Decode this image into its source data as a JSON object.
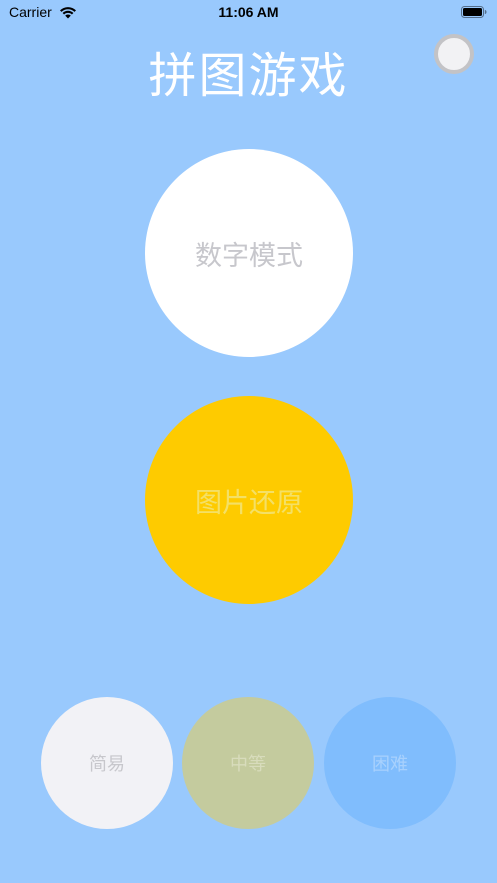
{
  "status_bar": {
    "carrier": "Carrier",
    "time": "11:06 AM",
    "wifi_icon": "wifi-icon",
    "battery_icon": "battery-icon"
  },
  "header": {
    "title": "拼图游戏",
    "toggle_icon": "circle-toggle-icon"
  },
  "modes": {
    "number_mode": "数字模式",
    "image_mode": "图片还原"
  },
  "difficulty": {
    "easy": "简易",
    "medium": "中等",
    "hard": "困难"
  },
  "colors": {
    "background": "#99c9fd",
    "number_mode_bg": "#ffffff",
    "image_mode_bg": "#fecb00",
    "easy_bg": "#f2f2f6",
    "medium_bg": "#c4cb9e",
    "hard_bg": "#80bdfd"
  }
}
